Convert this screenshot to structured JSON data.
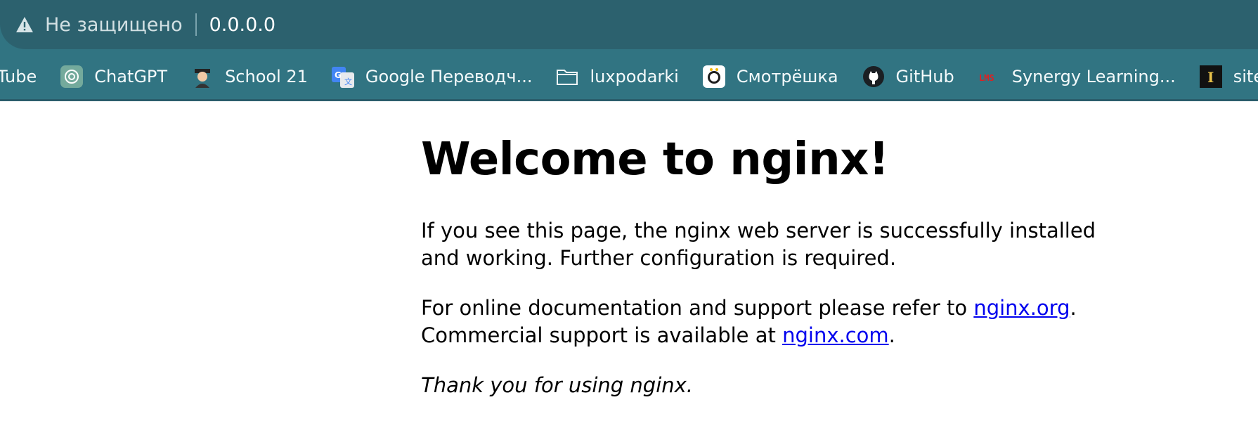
{
  "address_bar": {
    "security_label": "Не защищено",
    "url": "0.0.0.0"
  },
  "bookmarks": [
    {
      "label": "Tube",
      "icon": "youtube-icon"
    },
    {
      "label": "ChatGPT",
      "icon": "chatgpt-icon"
    },
    {
      "label": "School 21",
      "icon": "school21-icon"
    },
    {
      "label": "Google Переводч...",
      "icon": "google-translate-icon"
    },
    {
      "label": "luxpodarki",
      "icon": "folder-icon"
    },
    {
      "label": "Смотрёшка",
      "icon": "smotreshka-icon"
    },
    {
      "label": "GitHub",
      "icon": "github-icon"
    },
    {
      "label": "Synergy Learning...",
      "icon": "lms-icon"
    },
    {
      "label": "site",
      "icon": "site-icon"
    }
  ],
  "page": {
    "heading": "Welcome to nginx!",
    "p1": "If you see this page, the nginx web server is successfully installed and working. Further configuration is required.",
    "p2_before": "For online documentation and support please refer to ",
    "link_org": "nginx.org",
    "p2_mid": ".",
    "p2_line2": "Commercial support is available at ",
    "link_com": "nginx.com",
    "p2_end": ".",
    "p3": "Thank you for using nginx."
  },
  "colors": {
    "chrome_bg": "#317482",
    "omnibox_bg": "#2c616e",
    "link": "#0000ee"
  }
}
